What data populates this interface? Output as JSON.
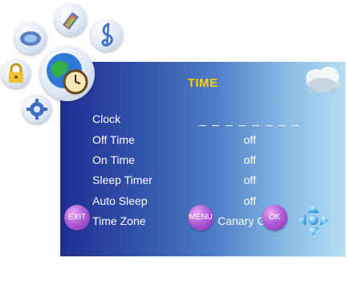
{
  "menu": {
    "title": "TIME",
    "rows": [
      {
        "label": "Clock",
        "value": "_ _  _ _    _ _ _ _"
      },
      {
        "label": "Off Time",
        "value": "off"
      },
      {
        "label": "On Time",
        "value": "off"
      },
      {
        "label": "Sleep Timer",
        "value": "off"
      },
      {
        "label": "Auto Sleep",
        "value": "off"
      },
      {
        "label": "Time Zone",
        "value": "Canary GMT"
      }
    ]
  },
  "footer": {
    "exit_label": "EXIT",
    "menu_label": "MENU",
    "ok_label": "OK"
  },
  "icons": {
    "left_cluster": [
      "picture-icon",
      "channel-icon",
      "sound-icon",
      "lock-icon",
      "time-icon",
      "setup-icon"
    ],
    "panel_corner": "weather-cloud-icon"
  },
  "colors": {
    "title": "#ffd000",
    "button": "#b15fd7"
  }
}
